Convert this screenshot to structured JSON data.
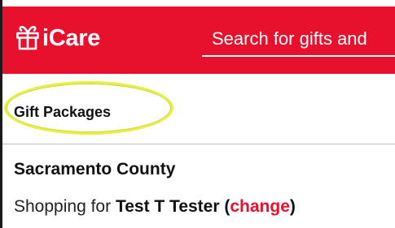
{
  "header": {
    "brand": "iCare",
    "logo_icon": "gift-icon",
    "search": {
      "placeholder": "Search for gifts and"
    },
    "color": "#e8112d"
  },
  "page": {
    "nav_title": "Gift Packages",
    "county": "Sacramento County",
    "shopping_prefix": "Shopping for ",
    "shopper_name": "Test T Tester",
    "paren_open": " (",
    "change_label": "change",
    "paren_close": ")"
  },
  "annotation": {
    "highlight_color": "#e7f03b"
  }
}
